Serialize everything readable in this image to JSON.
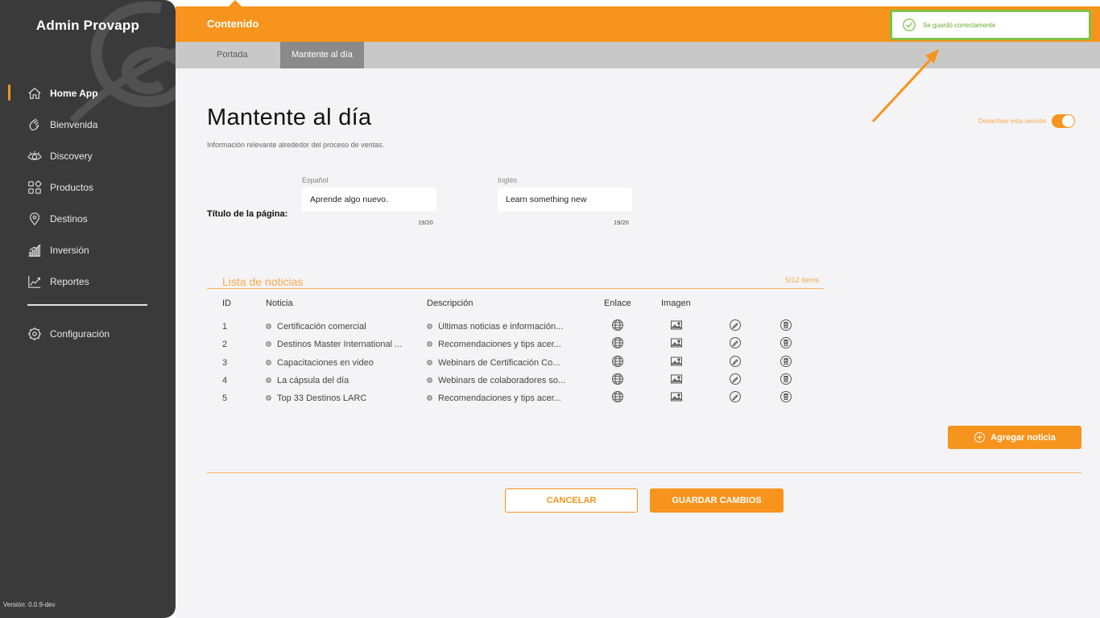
{
  "app": {
    "brand": "Admin Provapp",
    "version": "Versión: 0.0.9-dev"
  },
  "sidebar": {
    "items": [
      {
        "label": "Home App",
        "icon": "home-icon",
        "active": true
      },
      {
        "label": "Bienvenida",
        "icon": "wave-hand-icon"
      },
      {
        "label": "Discovery",
        "icon": "eye-icon"
      },
      {
        "label": "Productos",
        "icon": "grid-icon"
      },
      {
        "label": "Destinos",
        "icon": "location-pin-icon"
      },
      {
        "label": "Inversión",
        "icon": "bar-chart-icon"
      },
      {
        "label": "Reportes",
        "icon": "trend-chart-icon"
      }
    ],
    "config": {
      "label": "Configuración",
      "icon": "gear-icon"
    }
  },
  "topbar": {
    "title": "Contenido"
  },
  "tabs": [
    {
      "label": "Portada",
      "active": false
    },
    {
      "label": "Mantente al día",
      "active": true
    }
  ],
  "toast": {
    "message": "Se guardó correctamente",
    "icon": "check-circle-icon"
  },
  "page": {
    "title": "Mantente al día",
    "subtitle": "Información relevante alrededor del proceso de ventas.",
    "toggle_label": "Desactivar esta sección",
    "toggle_on": true
  },
  "form": {
    "row_label": "Título de la página:",
    "spanish": {
      "label": "Español",
      "value": "Aprende algo nuevo.",
      "counter": "19/20"
    },
    "english": {
      "label": "Inglés",
      "value": "Learn something new",
      "counter": "19/20"
    }
  },
  "list": {
    "title": "Lista de noticias",
    "count": "5/12 ítems",
    "headers": {
      "id": "ID",
      "noticia": "Noticia",
      "descripcion": "Descripción",
      "enlace": "Enlace",
      "imagen": "Imagen"
    },
    "rows": [
      {
        "id": "1",
        "noticia": "Certificación comercial",
        "descripcion": "Últimas noticias e información..."
      },
      {
        "id": "2",
        "noticia": "Destinos Master International ...",
        "descripcion": "Recomendaciones y tips acer..."
      },
      {
        "id": "3",
        "noticia": "Capacitaciones en video",
        "descripcion": "Webinars de Certificación Co..."
      },
      {
        "id": "4",
        "noticia": "La cápsula del día",
        "descripcion": "Webinars de colaboradores so..."
      },
      {
        "id": "5",
        "noticia": "Top 33 Destinos LARC",
        "descripcion": "Recomendaciones y tips acer..."
      }
    ]
  },
  "actions": {
    "add": "Agregar noticia",
    "cancel": "CANCELAR",
    "save": "GUARDAR CAMBIOS"
  },
  "colors": {
    "accent": "#f7941d",
    "sidebar": "#3a3a3a",
    "success": "#7dc242"
  }
}
